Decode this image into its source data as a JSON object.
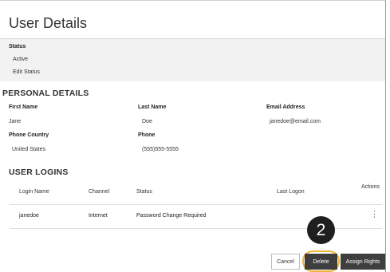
{
  "page": {
    "title": "User Details"
  },
  "status": {
    "label": "Status",
    "value": "Active",
    "edit_link": "Edit Status"
  },
  "personal_details": {
    "heading": "PERSONAL DETAILS",
    "first_name_label": "First Name",
    "first_name": "Jane",
    "last_name_label": "Last Name",
    "last_name": "Doe",
    "email_label": "Email Address",
    "email": "janedoe@email.com",
    "phone_country_label": "Phone Country",
    "phone_country": "United States",
    "phone_label": "Phone",
    "phone": "(555)555-5555"
  },
  "user_logins": {
    "heading": "USER LOGINS",
    "columns": [
      "Login Name",
      "Channel",
      "Status",
      "Last Logon",
      "Actions"
    ],
    "rows": [
      {
        "login_name": "janedoe",
        "channel": "Internet",
        "status": "Password Change Required",
        "last_logon": "",
        "actions_icon": "kebab-menu-icon"
      }
    ]
  },
  "callout": {
    "number": "2",
    "color": "#f0b33a"
  },
  "footer": {
    "cancel_label": "Cancel",
    "delete_label": "Delete",
    "assign_rights_label": "Assign Rights"
  }
}
